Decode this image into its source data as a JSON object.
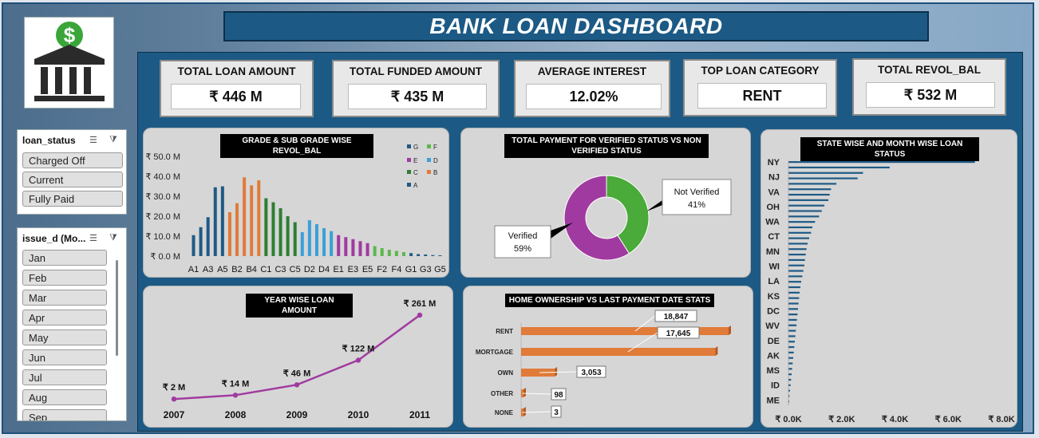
{
  "title": "BANK LOAN DASHBOARD",
  "logo": {
    "icon": "bank-dollar-icon",
    "accent": "#3aa63a"
  },
  "slicers": {
    "loan_status": {
      "title": "loan_status",
      "items": [
        "Charged Off",
        "Current",
        "Fully Paid"
      ]
    },
    "issue_d": {
      "title": "issue_d (Mo...",
      "items": [
        "Jan",
        "Feb",
        "Mar",
        "Apr",
        "May",
        "Jun",
        "Jul",
        "Aug",
        "Sep"
      ]
    }
  },
  "kpis": [
    {
      "label": "TOTAL LOAN AMOUNT",
      "value": "₹ 446 M"
    },
    {
      "label": "TOTAL FUNDED AMOUNT",
      "value": "₹ 435 M"
    },
    {
      "label": "AVERAGE INTEREST",
      "value": "12.02%"
    },
    {
      "label": "TOP LOAN CATEGORY",
      "value": "RENT"
    },
    {
      "label": "TOTAL REVOL_BAL",
      "value": "₹ 532 M"
    }
  ],
  "colors": {
    "A": "#1f5a85",
    "B": "#e07b39",
    "C": "#2e7d32",
    "D": "#3aa0d8",
    "E": "#a03aa0",
    "F": "#5cb84a",
    "G": "#1f5a85",
    "line": "#a03aa0",
    "bar": "#e07b39"
  },
  "chart_data": [
    {
      "id": "grade",
      "type": "bar",
      "title": "GRADE & SUB GRADE WISE REVOL_BAL",
      "ylim": [
        0,
        50
      ],
      "yticks": [
        "₹ 0.0 M",
        "₹ 10.0 M",
        "₹ 20.0 M",
        "₹ 30.0 M",
        "₹ 40.0 M",
        "₹ 50.0 M"
      ],
      "x_labels": [
        "A1",
        "A3",
        "A5",
        "B2",
        "B4",
        "C1",
        "C3",
        "C5",
        "D2",
        "D4",
        "E1",
        "E3",
        "E5",
        "F2",
        "F4",
        "G1",
        "G3",
        "G5"
      ],
      "categories": [
        "A1",
        "A2",
        "A3",
        "A4",
        "A5",
        "B1",
        "B2",
        "B3",
        "B4",
        "B5",
        "C1",
        "C2",
        "C3",
        "C4",
        "C5",
        "D1",
        "D2",
        "D3",
        "D4",
        "D5",
        "E1",
        "E2",
        "E3",
        "E4",
        "E5",
        "F1",
        "F2",
        "F3",
        "F4",
        "F5",
        "G1",
        "G2",
        "G3",
        "G4",
        "G5"
      ],
      "values": [
        10.5,
        14.5,
        19.5,
        34.5,
        35,
        22,
        26.5,
        39.5,
        35.5,
        38,
        29,
        27,
        24,
        20,
        17,
        12,
        18,
        16,
        14,
        12.5,
        10.5,
        9.5,
        8.5,
        7.5,
        6.5,
        5,
        4,
        3.2,
        2.6,
        2,
        1.5,
        1,
        0.8,
        0.5,
        0.4
      ],
      "legend": [
        "G",
        "F",
        "E",
        "D",
        "C",
        "B",
        "A"
      ]
    },
    {
      "id": "verify",
      "type": "pie",
      "title": "TOTAL PAYMENT FOR VERIFIED STATUS VS NON VERIFIED STATUS",
      "slices": [
        {
          "name": "Not Verified",
          "value": 41,
          "label": "41%",
          "color": "#4aaa3a"
        },
        {
          "name": "Verified",
          "value": 59,
          "label": "59%",
          "color": "#a03aa0"
        }
      ]
    },
    {
      "id": "state",
      "type": "bar",
      "title": "STATE WISE AND MONTH WISE LOAN STATUS",
      "categories": [
        "NY",
        "NJ",
        "VA",
        "OH",
        "WA",
        "CT",
        "MN",
        "WI",
        "LA",
        "KS",
        "DC",
        "WV",
        "DE",
        "AK",
        "MS",
        "ID",
        "ME"
      ],
      "values": [
        7000,
        3800,
        2800,
        2600,
        1800,
        1600,
        1550,
        1500,
        1350,
        1250,
        1150,
        1000,
        900,
        850,
        780,
        720,
        680,
        650,
        620,
        600,
        560,
        520,
        480,
        450,
        420,
        400,
        380,
        360,
        340,
        320,
        300,
        280,
        260,
        240,
        220,
        200,
        180,
        160,
        140,
        120,
        100,
        80,
        60,
        40,
        20
      ],
      "xticks": [
        "₹ 0.0K",
        "₹ 2.0K",
        "₹ 4.0K",
        "₹ 6.0K",
        "₹ 8.0K"
      ],
      "xlim": [
        0,
        8000
      ]
    },
    {
      "id": "year",
      "type": "line",
      "title": "YEAR WISE LOAN AMOUNT",
      "x": [
        "2007",
        "2008",
        "2009",
        "2010",
        "2011"
      ],
      "values": [
        2,
        14,
        46,
        122,
        261
      ],
      "labels": [
        "₹ 2 M",
        "₹ 14 M",
        "₹ 46 M",
        "₹ 122 M",
        "₹ 261 M"
      ]
    },
    {
      "id": "home",
      "type": "bar",
      "title": "HOME OWNERSHIP VS LAST PAYMENT DATE STATS",
      "categories": [
        "RENT",
        "MORTGAGE",
        "OWN",
        "OTHER",
        "NONE"
      ],
      "values": [
        18847,
        17645,
        3053,
        98,
        3
      ],
      "labels": [
        "18,847",
        "17,645",
        "3,053",
        "98",
        "3"
      ]
    }
  ]
}
